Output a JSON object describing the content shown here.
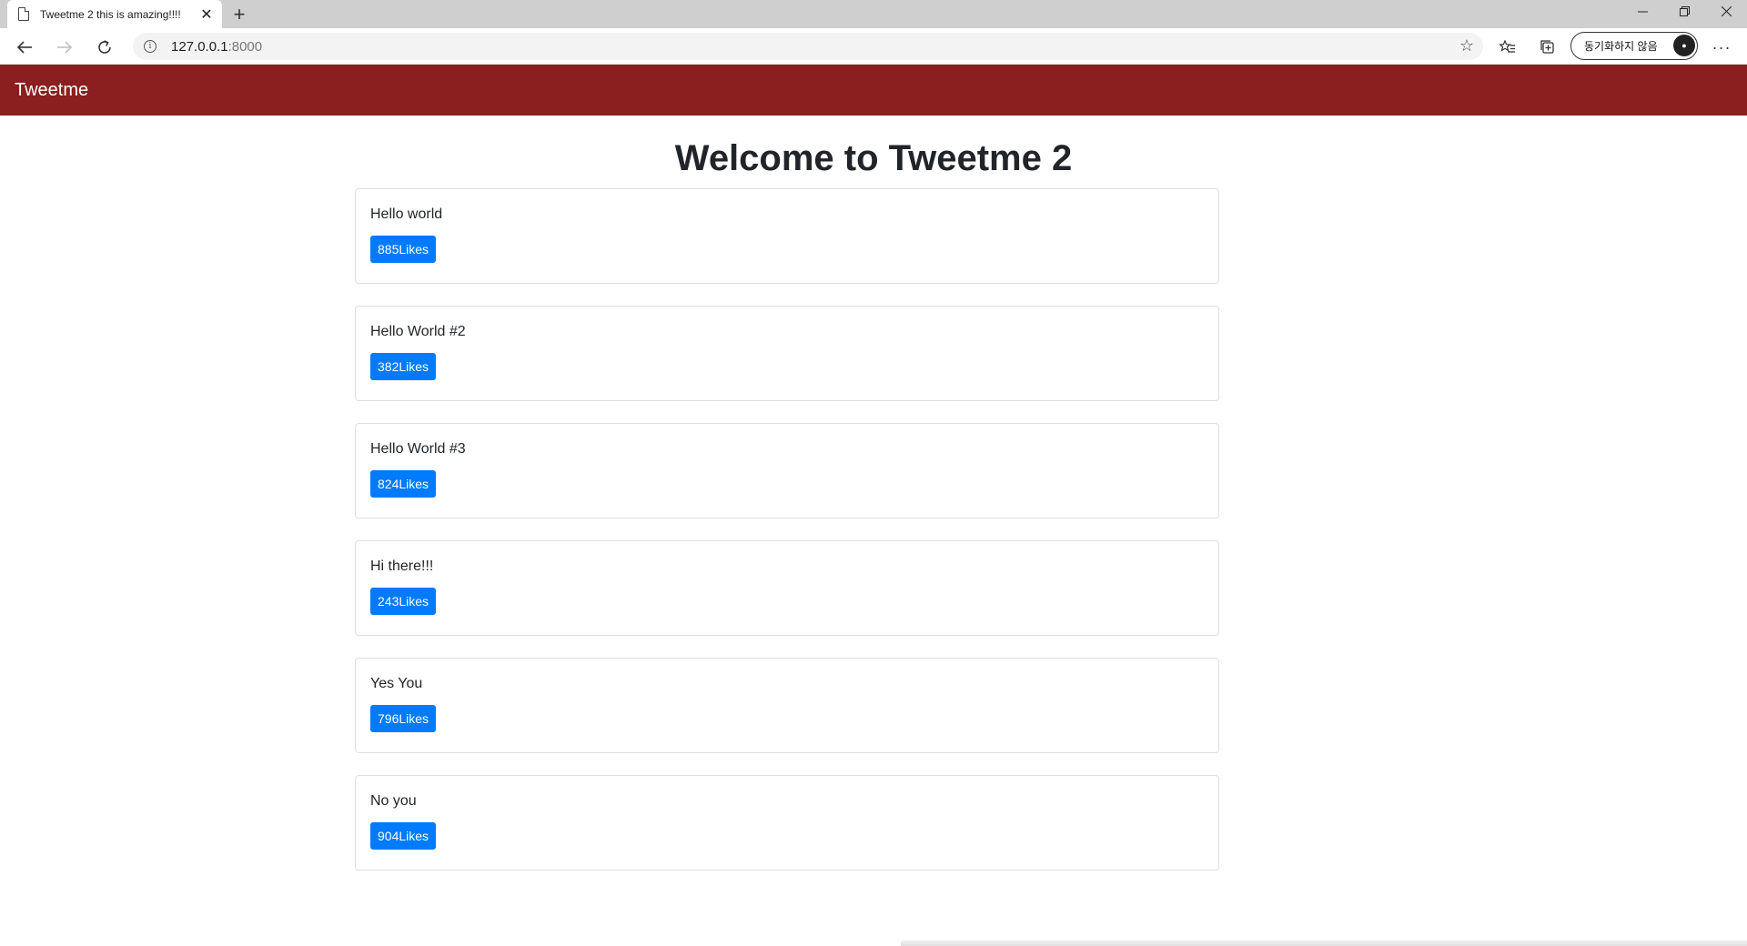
{
  "browser": {
    "tab_title": "Tweetme 2 this is amazing!!!!",
    "tab_close": "✕",
    "new_tab": "+",
    "url_host": "127.0.0.1",
    "url_port": ":8000",
    "sync_label": "동기화하지 않음",
    "icons": {
      "back": "back-arrow-icon",
      "forward": "forward-arrow-icon",
      "reload": "reload-icon",
      "info": "info-icon",
      "star": "star-icon",
      "favorites": "favorites-icon",
      "collections": "collections-icon",
      "menu": "more-menu-icon"
    }
  },
  "navbar": {
    "brand": "Tweetme",
    "color": "#8b1e1e"
  },
  "page": {
    "title": "Welcome to Tweetme 2"
  },
  "tweets": [
    {
      "content": "Hello world",
      "likes": "885",
      "likes_suffix": "Likes"
    },
    {
      "content": "Hello World #2",
      "likes": "382",
      "likes_suffix": "Likes"
    },
    {
      "content": "Hello World #3",
      "likes": "824",
      "likes_suffix": "Likes"
    },
    {
      "content": "Hi there!!!",
      "likes": "243",
      "likes_suffix": "Likes"
    },
    {
      "content": "Yes You",
      "likes": "796",
      "likes_suffix": "Likes"
    },
    {
      "content": "No you",
      "likes": "904",
      "likes_suffix": "Likes"
    }
  ],
  "colors": {
    "like_button": "#007bff"
  }
}
